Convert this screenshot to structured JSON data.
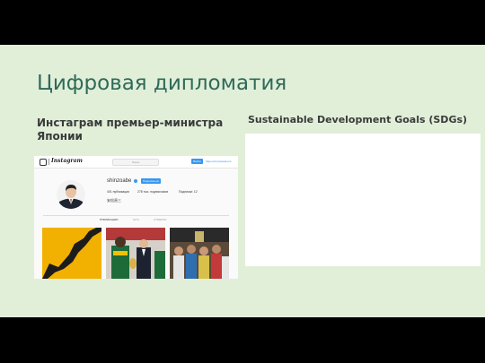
{
  "slide": {
    "title": "Цифровая дипломатия",
    "left_heading": "Инстаграм премьер-министра Японии",
    "right_heading": "Sustainable Development Goals (SDGs)"
  },
  "instagram": {
    "logo": "Instagram",
    "search_placeholder": "Поиск",
    "login_label": "Войти",
    "signup_label": "Зарегистрироваться",
    "username": "shinzoabe",
    "follow_label": "Подписаться",
    "stats": {
      "posts": "401 публикация",
      "followers": "278 тыс. подписчиков",
      "following": "Подписки: 12"
    },
    "name": "安倍晋三",
    "tabs": [
      "ПУБЛИКАЦИИ",
      "IGTV",
      "ОТМЕТКИ"
    ],
    "colors": {
      "accent": "#3897f0",
      "slide_bg": "#e1efd9",
      "title": "#2f6a59"
    }
  }
}
